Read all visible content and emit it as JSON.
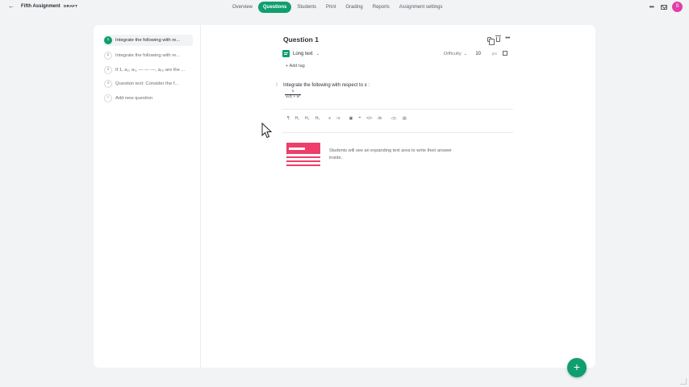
{
  "header": {
    "back_icon": "arrow-left-icon",
    "title": "Fifth Assignment",
    "badge": "DRAFT",
    "tabs": [
      {
        "label": "Overview"
      },
      {
        "label": "Questions"
      },
      {
        "label": "Students"
      },
      {
        "label": "Print"
      },
      {
        "label": "Grading"
      },
      {
        "label": "Reports"
      },
      {
        "label": "Assignment settings"
      }
    ],
    "more_icon": "more-horizontal-icon",
    "mail_icon": "mail-icon",
    "avatar_initial": "S",
    "avatar_color": "#e13ea7"
  },
  "sidebar": {
    "items": [
      {
        "num": "1",
        "text": "Integrate the following with re..."
      },
      {
        "num": "2",
        "text": "Integrate the following with re..."
      },
      {
        "num": "3",
        "text": "If 1, a₂, a₃, — — —, a₁₀ are the ..."
      },
      {
        "num": "4",
        "text": "Question text: Consider the f..."
      }
    ],
    "add_label": "Add new question",
    "add_icon": "plus-icon"
  },
  "question": {
    "title": "Question 1",
    "type_label": "Long text",
    "difficulty_label": "Difficulty",
    "points_value": "10",
    "points_label": "pts",
    "add_tag_label": "+ Add tag",
    "prompt": "Integrate the following with respect to x :",
    "fraction": {
      "numerator": "1",
      "denominator": "x√1 + x²"
    },
    "toolbar": [
      "¶",
      "H₁",
      "H₂",
      "H₃",
      "≡",
      "⁝≡",
      "▣",
      "❝",
      "</>",
      "∂x",
      "◁▷",
      "▤"
    ],
    "info_text": "Students will see an expanding text area to write their answer inside."
  },
  "colors": {
    "accent": "#0f9f6e",
    "illustration": "#ee3d6a"
  },
  "fab_label": "+"
}
